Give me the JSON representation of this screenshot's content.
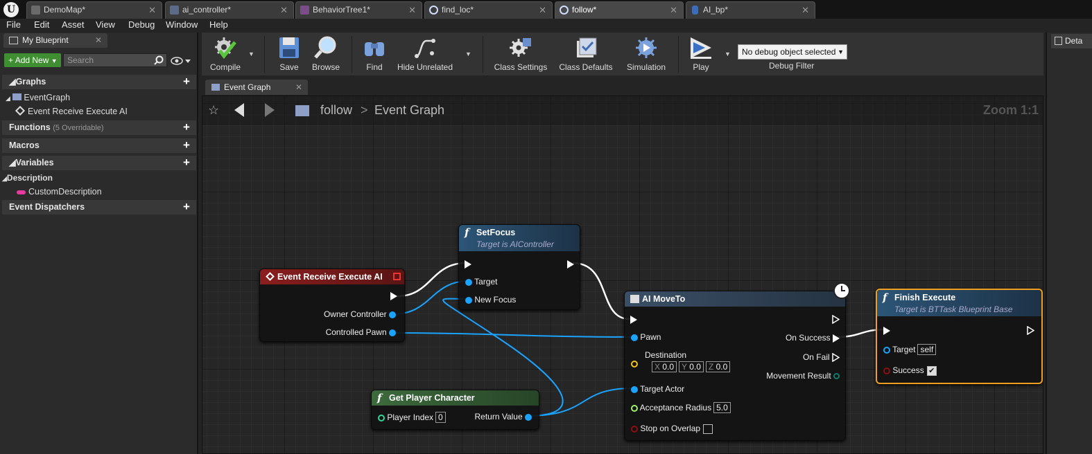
{
  "tabs": [
    {
      "label": "DemoMap*",
      "icon": "map-icon"
    },
    {
      "label": "ai_controller*",
      "icon": "blueprint-icon"
    },
    {
      "label": "BehaviorTree1*",
      "icon": "behavior-tree-icon"
    },
    {
      "label": "find_loc*",
      "icon": "task-circle-icon"
    },
    {
      "label": "follow*",
      "icon": "task-circle-icon"
    },
    {
      "label": "AI_bp*",
      "icon": "character-icon"
    }
  ],
  "menu": [
    "File",
    "Edit",
    "Asset",
    "View",
    "Debug",
    "Window",
    "Help"
  ],
  "left_panel": {
    "tab": "My Blueprint",
    "add_new": "Add New",
    "search_placeholder": "Search",
    "graphs_label": "Graphs",
    "event_graph": "EventGraph",
    "event_item": "Event Receive Execute AI",
    "functions_label": "Functions",
    "functions_count": "(5 Overridable)",
    "macros_label": "Macros",
    "variables_label": "Variables",
    "description_label": "Description",
    "custom_description": "CustomDescription",
    "dispatchers_label": "Event Dispatchers",
    "variable_color": "#e43b9c"
  },
  "toolbar": {
    "compile": "Compile",
    "save": "Save",
    "browse": "Browse",
    "find": "Find",
    "hide_unrelated": "Hide Unrelated",
    "class_settings": "Class Settings",
    "class_defaults": "Class Defaults",
    "simulation": "Simulation",
    "play": "Play",
    "debug_object": "No debug object selected",
    "debug_filter": "Debug Filter"
  },
  "right_panel": {
    "tab": "Deta"
  },
  "graph": {
    "tab": "Event Graph",
    "crumb_root": "follow",
    "crumb_sep": ">",
    "crumb_current": "Event Graph",
    "zoom": "Zoom 1:1"
  },
  "nodes": {
    "event": {
      "title": "Event Receive Execute AI",
      "owner": "Owner Controller",
      "pawn": "Controlled Pawn",
      "color": "#7a1c1c"
    },
    "setfocus": {
      "title": "SetFocus",
      "sub": "Target is AIController",
      "target": "Target",
      "focus": "New Focus"
    },
    "getplayer": {
      "title": "Get Player Character",
      "index_label": "Player Index",
      "index_value": "0",
      "ret": "Return Value"
    },
    "moveto": {
      "title": "AI MoveTo",
      "pawn": "Pawn",
      "destination": "Destination",
      "x_label": "X",
      "x": "0.0",
      "y_label": "Y",
      "y": "0.0",
      "z_label": "Z",
      "z": "0.0",
      "target_actor": "Target Actor",
      "acceptance": "Acceptance Radius",
      "acceptance_value": "5.0",
      "stop_overlap": "Stop on Overlap",
      "on_success": "On Success",
      "on_fail": "On Fail",
      "movement_result": "Movement Result"
    },
    "finish": {
      "title": "Finish Execute",
      "sub": "Target is BTTask Blueprint Base",
      "target": "Target",
      "target_value": "self",
      "success": "Success",
      "success_checked": "✔"
    }
  },
  "colors": {
    "object_pin": "#1aa3ff",
    "vector_pin": "#f5c518",
    "float_pin": "#9cf36b",
    "bool_pin": "#8e0f0f",
    "selection": "#f0a020"
  }
}
